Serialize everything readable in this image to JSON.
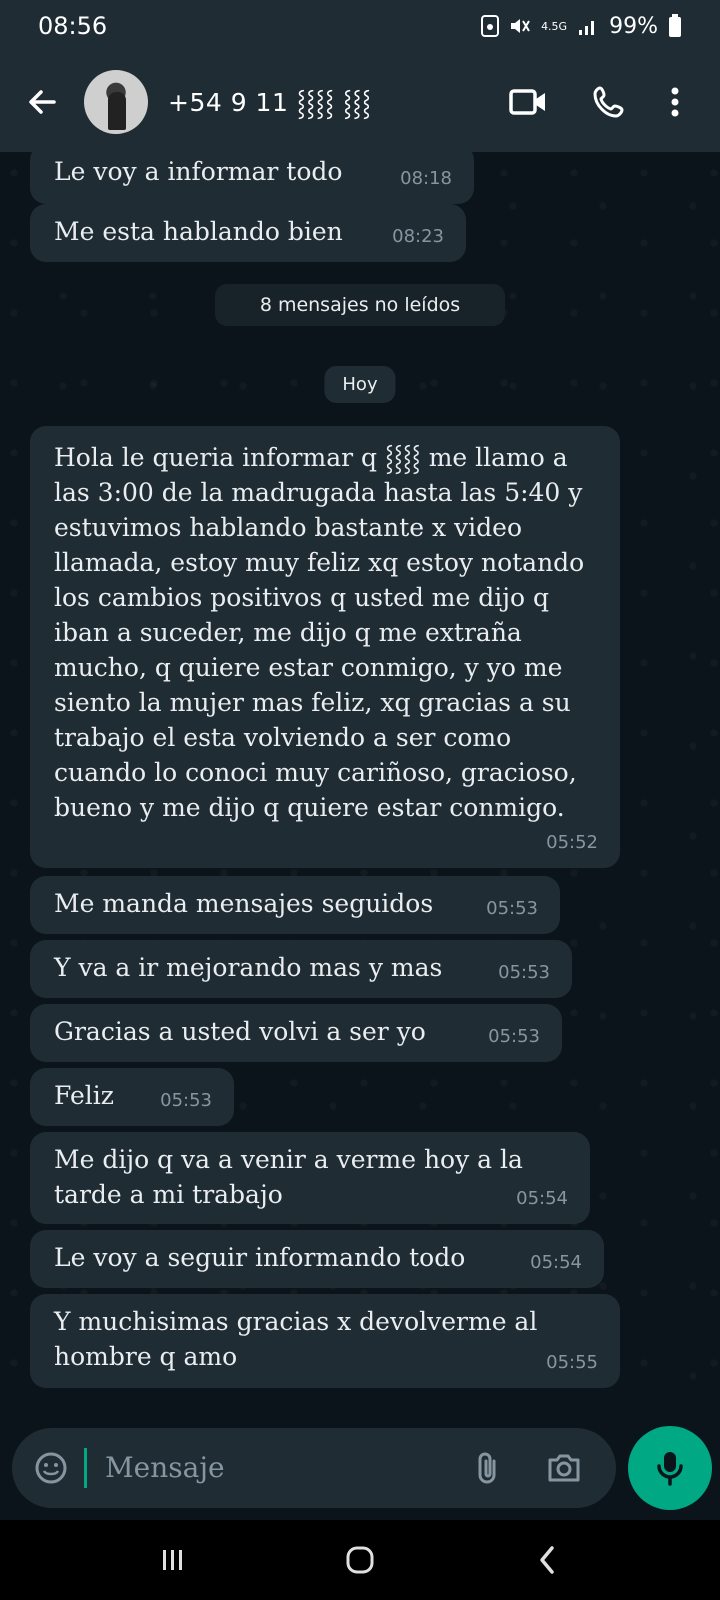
{
  "status_bar": {
    "time": "08:56",
    "network": "4.5G",
    "battery": "99%"
  },
  "header": {
    "contact": "+54 9 11 ⸾⸾⸾⸾ ⸾⸾⸾",
    "icons": [
      "back-arrow-icon",
      "video-call-icon",
      "phone-icon",
      "more-vert-icon"
    ]
  },
  "messages": [
    {
      "text": "Le voy a informar todo",
      "time": "08:18"
    },
    {
      "text": "Me esta hablando bien",
      "time": "08:23"
    }
  ],
  "unread_label": "8 mensajes no leídos",
  "date_label": "Hoy",
  "today_messages": [
    {
      "text": "Hola le queria informar q ⸾⸾⸾⸾ me llamo a las 3:00 de la madrugada hasta las 5:40 y estuvimos hablando bastante x video llamada, estoy muy feliz xq estoy notando los cambios positivos q usted me dijo q iban a suceder, me dijo q me extraña mucho, q quiere estar conmigo, y yo me siento la mujer mas feliz, xq gracias a su trabajo el esta volviendo a ser como cuando lo conoci muy cariñoso, gracioso, bueno y me dijo q quiere estar conmigo.",
      "time": "05:52"
    },
    {
      "text": "Me manda mensajes seguidos",
      "time": "05:53"
    },
    {
      "text": "Y va a ir mejorando mas y mas",
      "time": "05:53"
    },
    {
      "text": "Gracias a usted volvi a ser yo",
      "time": "05:53"
    },
    {
      "text": "Feliz",
      "time": "05:53"
    },
    {
      "text": "Me dijo q va a venir a verme hoy a la tarde a mi trabajo",
      "time": "05:54"
    },
    {
      "text": "Le voy a seguir informando todo",
      "time": "05:54"
    },
    {
      "text": "Y muchisimas gracias x devolverme al hombre q amo",
      "time": "05:55"
    }
  ],
  "composer": {
    "placeholder": "Mensaje",
    "icons": [
      "emoji-icon",
      "attach-icon",
      "camera-icon",
      "mic-icon"
    ]
  },
  "colors": {
    "background": "#0b141a",
    "bubble": "#1f2c34",
    "accent": "#00a884",
    "timestamp": "#8696a0"
  }
}
